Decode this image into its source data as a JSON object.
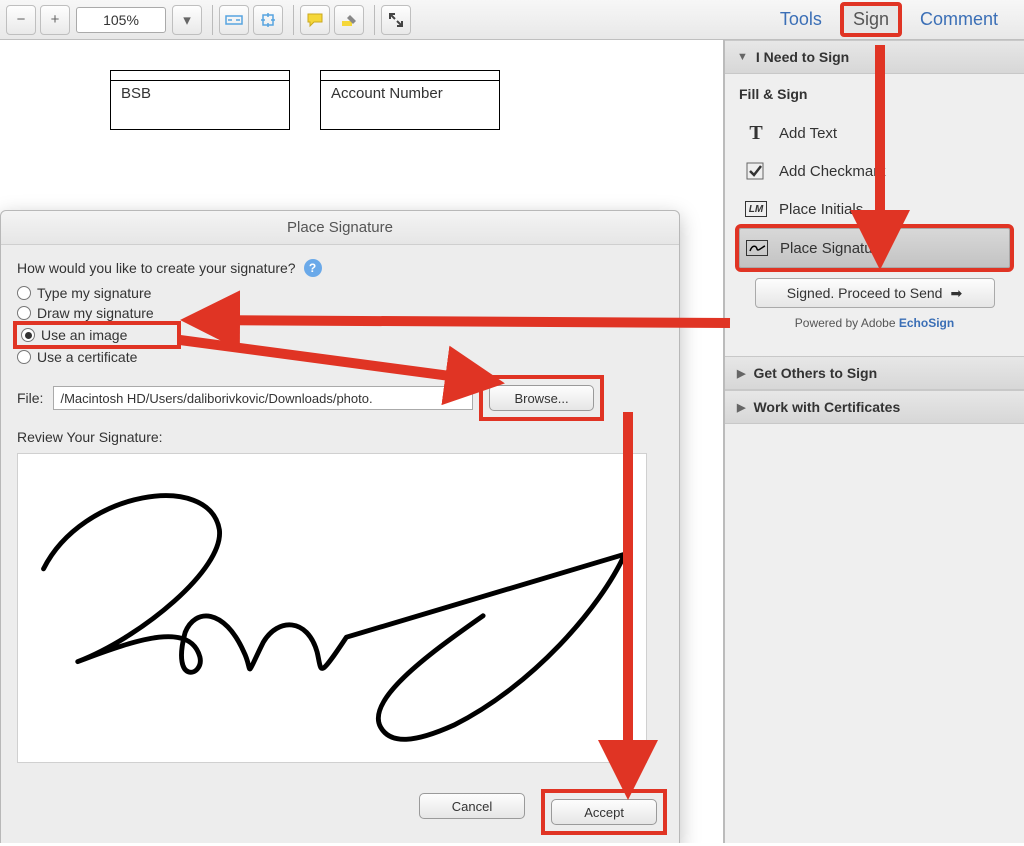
{
  "toolbar": {
    "zoom": "105%",
    "links": {
      "tools": "Tools",
      "sign": "Sign",
      "comment": "Comment"
    }
  },
  "doc": {
    "bsb_label": "BSB",
    "acct_label": "Account Number"
  },
  "dialog": {
    "title": "Place Signature",
    "question": "How would you like to create your signature?",
    "opt_type": "Type my signature",
    "opt_draw": "Draw my signature",
    "opt_image": "Use an image",
    "opt_cert": "Use a certificate",
    "file_label": "File:",
    "file_value": "/Macintosh HD/Users/daliborivkovic/Downloads/photo.",
    "browse": "Browse...",
    "review": "Review Your Signature:",
    "cancel": "Cancel",
    "accept": "Accept"
  },
  "sidebar": {
    "need_to_sign": "I Need to Sign",
    "fill_sign": "Fill & Sign",
    "add_text": "Add Text",
    "add_checkmark": "Add Checkmark",
    "place_initials": "Place Initials",
    "place_signature": "Place Signature",
    "proceed": "Signed. Proceed to Send",
    "powered_prefix": "Powered by Adobe ",
    "powered_link": "EchoSign",
    "get_others": "Get Others to Sign",
    "work_cert": "Work with Certificates"
  }
}
